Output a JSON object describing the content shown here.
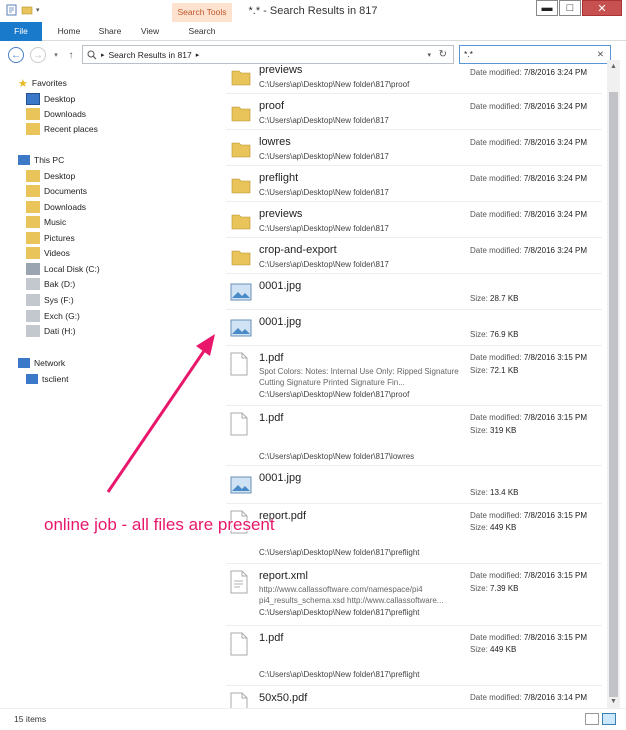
{
  "window": {
    "title": "*.* - Search Results in 817",
    "min": "▬",
    "max": "□",
    "close": "✕"
  },
  "ribbon": {
    "context_header": "Search Tools",
    "tabs": [
      "File",
      "Home",
      "Share",
      "View",
      "Search"
    ]
  },
  "address": {
    "path": "Search Results in 817",
    "search_value": "*.*"
  },
  "nav": {
    "favorites": "Favorites",
    "fav_items": [
      "Desktop",
      "Downloads",
      "Recent places"
    ],
    "this_pc": "This PC",
    "pc_items": [
      "Desktop",
      "Documents",
      "Downloads",
      "Music",
      "Pictures",
      "Videos",
      "Local Disk (C:)",
      "Bak (D:)",
      "Sys (F:)",
      "Exch (G:)",
      "Dati (H:)"
    ],
    "network": "Network",
    "net_items": [
      "tsclient"
    ]
  },
  "files": [
    {
      "name": "previews",
      "type": "folder",
      "path": "C:\\Users\\ap\\Desktop\\New folder\\817\\proof",
      "date_label": "Date modified:",
      "date": "7/8/2016 3:24 PM"
    },
    {
      "name": "proof",
      "type": "folder",
      "path": "C:\\Users\\ap\\Desktop\\New folder\\817",
      "date_label": "Date modified:",
      "date": "7/8/2016 3:24 PM"
    },
    {
      "name": "lowres",
      "type": "folder",
      "path": "C:\\Users\\ap\\Desktop\\New folder\\817",
      "date_label": "Date modified:",
      "date": "7/8/2016 3:24 PM"
    },
    {
      "name": "preflight",
      "type": "folder",
      "path": "C:\\Users\\ap\\Desktop\\New folder\\817",
      "date_label": "Date modified:",
      "date": "7/8/2016 3:24 PM"
    },
    {
      "name": "previews",
      "type": "folder",
      "path": "C:\\Users\\ap\\Desktop\\New folder\\817",
      "date_label": "Date modified:",
      "date": "7/8/2016 3:24 PM"
    },
    {
      "name": "crop-and-export",
      "type": "folder",
      "path": "C:\\Users\\ap\\Desktop\\New folder\\817",
      "date_label": "Date modified:",
      "date": "7/8/2016 3:24 PM"
    },
    {
      "name": "0001.jpg",
      "type": "image",
      "size_label": "Size:",
      "size": "28.7 KB"
    },
    {
      "name": "0001.jpg",
      "type": "image",
      "size_label": "Size:",
      "size": "76.9 KB"
    },
    {
      "name": "1.pdf",
      "type": "doc",
      "desc": "Spot Colors: Notes: Internal Use Only: Ripped Signature Cutting Signature Printed Signature Fin...",
      "path": "C:\\Users\\ap\\Desktop\\New folder\\817\\proof",
      "date_label": "Date modified:",
      "date": "7/8/2016 3:15 PM",
      "size_label": "Size:",
      "size": "72.1 KB"
    },
    {
      "name": "1.pdf",
      "type": "doc",
      "path": "C:\\Users\\ap\\Desktop\\New folder\\817\\lowres",
      "date_label": "Date modified:",
      "date": "7/8/2016 3:15 PM",
      "size_label": "Size:",
      "size": "319 KB"
    },
    {
      "name": "0001.jpg",
      "type": "image",
      "size_label": "Size:",
      "size": "13.4 KB"
    },
    {
      "name": "report.pdf",
      "type": "doc",
      "path": "C:\\Users\\ap\\Desktop\\New folder\\817\\preflight",
      "date_label": "Date modified:",
      "date": "7/8/2016 3:15 PM",
      "size_label": "Size:",
      "size": "449 KB"
    },
    {
      "name": "report.xml",
      "type": "xml",
      "desc": "http://www.callassoftware.com/namespace/pi4 pi4_results_schema.xsd http://www.callassoftware...",
      "path": "C:\\Users\\ap\\Desktop\\New folder\\817\\preflight",
      "date_label": "Date modified:",
      "date": "7/8/2016 3:15 PM",
      "size_label": "Size:",
      "size": "7.39 KB"
    },
    {
      "name": "1.pdf",
      "type": "doc",
      "path": "C:\\Users\\ap\\Desktop\\New folder\\817\\preflight",
      "date_label": "Date modified:",
      "date": "7/8/2016 3:15 PM",
      "size_label": "Size:",
      "size": "449 KB"
    },
    {
      "name": "50x50.pdf",
      "type": "doc",
      "date_label": "Date modified:",
      "date": "7/8/2016 3:14 PM"
    }
  ],
  "status": {
    "count": "15 items"
  },
  "annotation": {
    "text": "online job - all files are present",
    "color": "#e8176b"
  },
  "colors": {
    "accent": "#1979ca",
    "folder": "#e8c45a",
    "annotation": "#e8176b"
  }
}
